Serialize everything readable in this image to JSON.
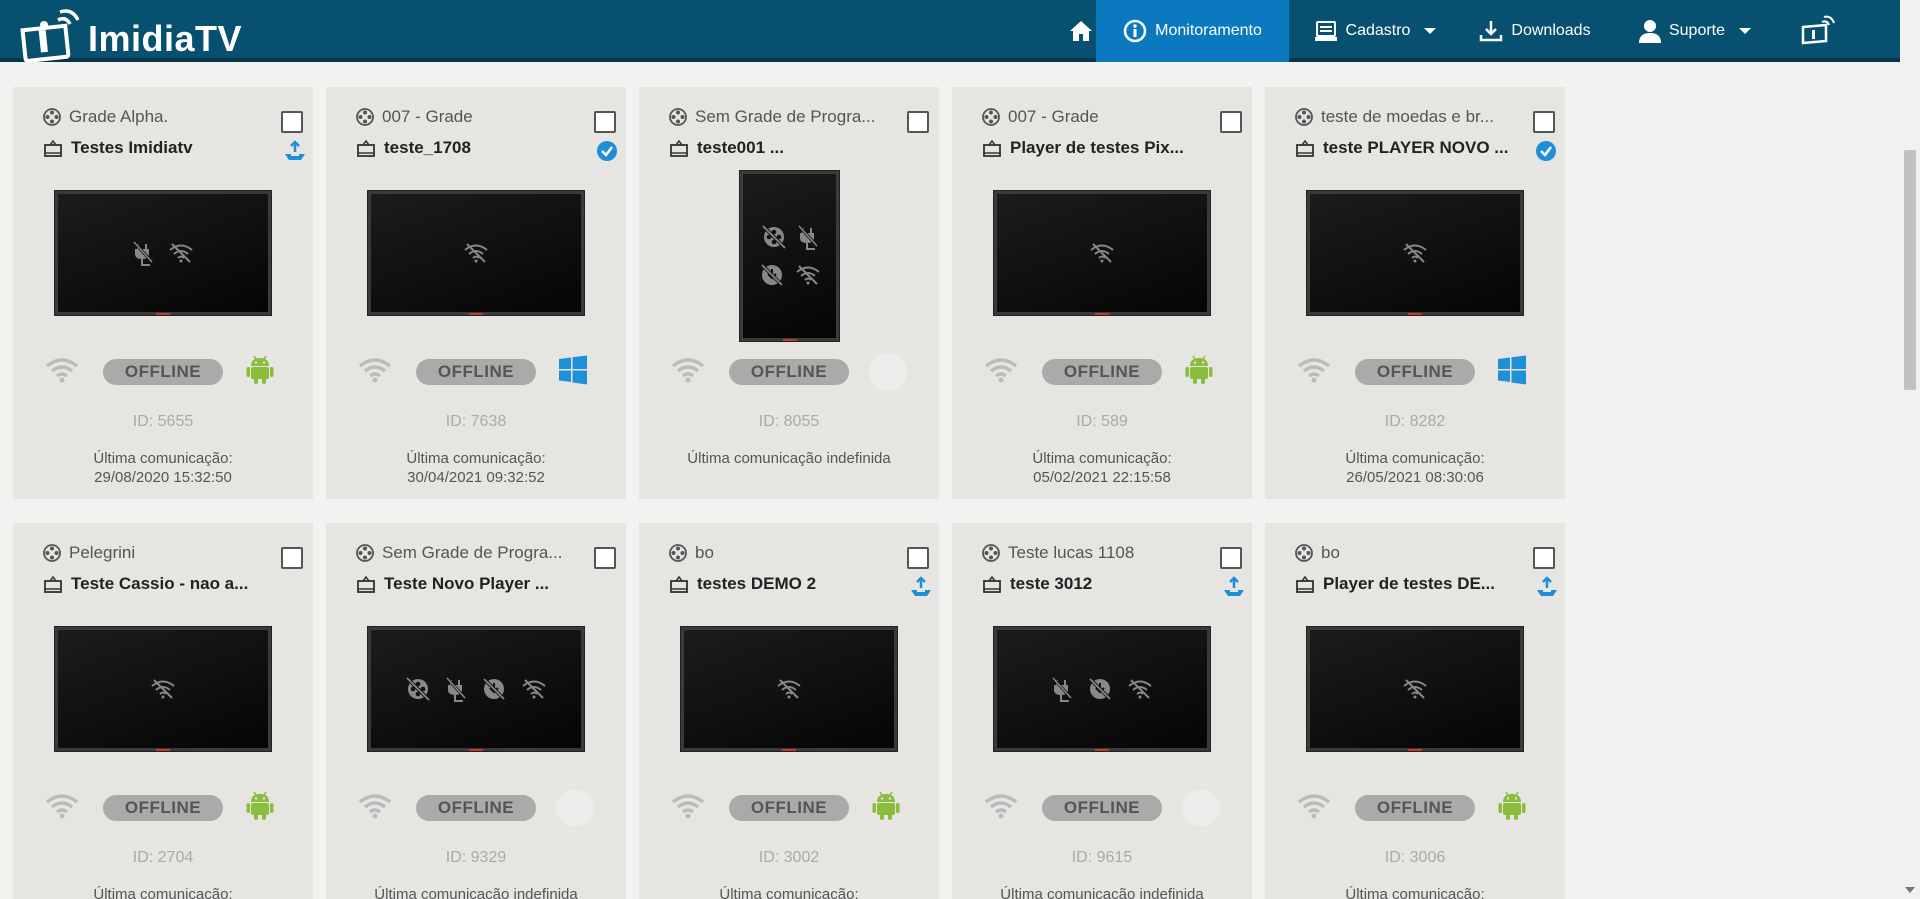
{
  "app": {
    "name": "ImidiaTV"
  },
  "nav": {
    "home_icon": "home-icon",
    "items": [
      {
        "label": "Monitoramento",
        "icon": "info-circle-icon",
        "active": true
      },
      {
        "label": "Cadastro",
        "icon": "register-icon",
        "dropdown": true
      },
      {
        "label": "Downloads",
        "icon": "download-icon"
      },
      {
        "label": "Suporte",
        "icon": "user-icon",
        "dropdown": true
      }
    ],
    "cast_icon": "cast-icon"
  },
  "colors": {
    "header_bg": "#07506f",
    "active_nav": "#0b79c0",
    "card_bg": "#e6e5e2",
    "badge_bg": "#aaaaa8",
    "android_green": "#8bbd3d",
    "windows_blue": "#1e90d6",
    "accent_blue": "#1e8fd6"
  },
  "cards": [
    {
      "grade": "Grade Alpha.",
      "player": "Testes Imidiatv",
      "status": "upload",
      "screen": "land",
      "icons": [
        "plug-off",
        "wifi-off"
      ],
      "badge": "OFFLINE",
      "os": "android",
      "id": "ID: 5655",
      "comm_label": "Última comunicação:",
      "comm_date": "29/08/2020 15:32:50"
    },
    {
      "grade": "007 - Grade",
      "player": "teste_1708",
      "status": "check",
      "screen": "land",
      "icons": [
        "wifi-off"
      ],
      "badge": "OFFLINE",
      "os": "windows",
      "id": "ID: 7638",
      "comm_label": "Última comunicação:",
      "comm_date": "30/04/2021 09:32:52"
    },
    {
      "grade": "Sem Grade de Progra...",
      "player": "teste001   ...",
      "status": "",
      "screen": "port",
      "icons": [
        "film-off",
        "plug-off",
        "download-off",
        "wifi-off"
      ],
      "badge": "OFFLINE",
      "os": "none",
      "id": "ID: 8055",
      "comm_label": "Última comunicação indefinida",
      "comm_date": ""
    },
    {
      "grade": "007 - Grade",
      "player": "Player de testes Pix...",
      "status": "",
      "screen": "land",
      "icons": [
        "wifi-off"
      ],
      "badge": "OFFLINE",
      "os": "android",
      "id": "ID: 589",
      "comm_label": "Última comunicação:",
      "comm_date": "05/02/2021 22:15:58"
    },
    {
      "grade": "teste de moedas e br...",
      "player": "teste PLAYER NOVO ...",
      "status": "check",
      "screen": "land",
      "icons": [
        "wifi-off"
      ],
      "badge": "OFFLINE",
      "os": "windows",
      "id": "ID: 8282",
      "comm_label": "Última comunicação:",
      "comm_date": "26/05/2021 08:30:06"
    },
    {
      "grade": "Pelegrini",
      "player": "Teste Cassio - nao a...",
      "status": "",
      "screen": "land",
      "icons": [
        "wifi-off"
      ],
      "badge": "OFFLINE",
      "os": "android",
      "id": "ID: 2704",
      "comm_label": "Última comunicação:",
      "comm_date": ""
    },
    {
      "grade": "Sem Grade de Progra...",
      "player": "Teste Novo Player   ...",
      "status": "",
      "screen": "land",
      "icons": [
        "film-off",
        "plug-off",
        "download-off",
        "wifi-off"
      ],
      "badge": "OFFLINE",
      "os": "none",
      "id": "ID: 9329",
      "comm_label": "Última comunicação indefinida",
      "comm_date": ""
    },
    {
      "grade": "bo",
      "player": "testes DEMO 2",
      "status": "upload",
      "screen": "land",
      "icons": [
        "wifi-off"
      ],
      "badge": "OFFLINE",
      "os": "android",
      "id": "ID: 3002",
      "comm_label": "Última comunicação:",
      "comm_date": ""
    },
    {
      "grade": "Teste lucas 1108",
      "player": "teste 3012",
      "status": "upload",
      "screen": "land",
      "icons": [
        "plug-off",
        "download-off",
        "wifi-off"
      ],
      "badge": "OFFLINE",
      "os": "none",
      "id": "ID: 9615",
      "comm_label": "Última comunicação indefinida",
      "comm_date": ""
    },
    {
      "grade": "bo",
      "player": "Player de testes DE...",
      "status": "upload",
      "screen": "land",
      "icons": [
        "wifi-off"
      ],
      "badge": "OFFLINE",
      "os": "android",
      "id": "ID: 3006",
      "comm_label": "Última comunicação:",
      "comm_date": ""
    }
  ]
}
